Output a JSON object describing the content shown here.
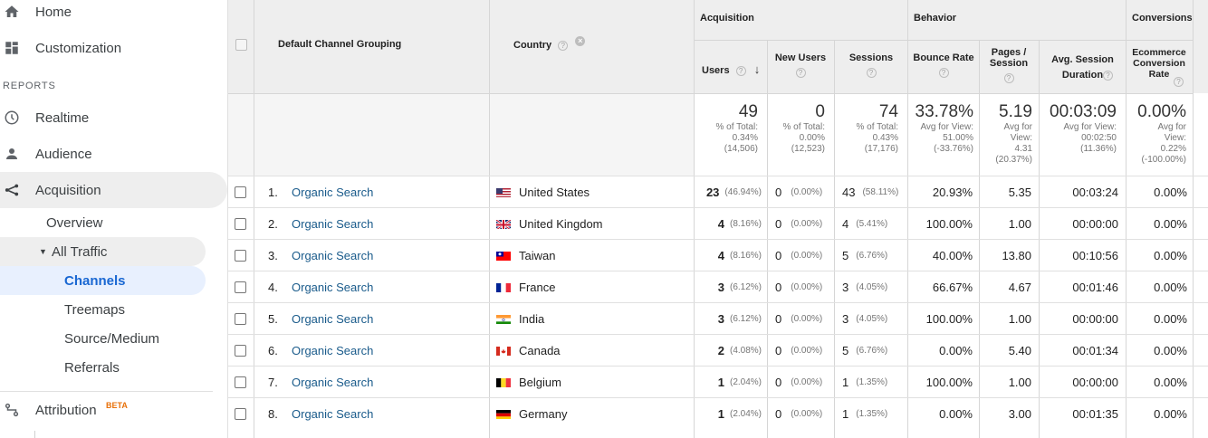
{
  "sidebar": {
    "home": "Home",
    "customization": "Customization",
    "reports_label": "REPORTS",
    "realtime": "Realtime",
    "audience": "Audience",
    "acquisition": "Acquisition",
    "overview": "Overview",
    "all_traffic": "All Traffic",
    "channels": "Channels",
    "treemaps": "Treemaps",
    "source_medium": "Source/Medium",
    "referrals": "Referrals",
    "attribution": "Attribution",
    "beta": "BETA"
  },
  "table": {
    "groups": {
      "acquisition": "Acquisition",
      "behavior": "Behavior",
      "conversions": "Conversions"
    },
    "columns": {
      "channel": "Default Channel Grouping",
      "country": "Country",
      "users": "Users",
      "new_users": "New Users",
      "sessions": "Sessions",
      "bounce_rate": "Bounce Rate",
      "pages_session": "Pages / Session",
      "avg_duration": "Avg. Session Duration",
      "ecom_rate": "Ecommerce Conversion Rate"
    },
    "totals": {
      "users": "49",
      "users_sub1": "% of Total:",
      "users_sub2": "0.34%",
      "users_sub3": "(14,506)",
      "new_users": "0",
      "new_users_sub1": "% of Total:",
      "new_users_sub2": "0.00%",
      "new_users_sub3": "(12,523)",
      "sessions": "74",
      "sessions_sub1": "% of Total:",
      "sessions_sub2": "0.43%",
      "sessions_sub3": "(17,176)",
      "bounce": "33.78%",
      "bounce_sub1": "Avg for View:",
      "bounce_sub2": "51.00%",
      "bounce_sub3": "(-33.76%)",
      "pages": "5.19",
      "pages_sub1": "Avg for",
      "pages_sub2": "View:",
      "pages_sub3": "4.31",
      "pages_sub4": "(20.37%)",
      "duration": "00:03:09",
      "duration_sub1": "Avg for View:",
      "duration_sub2": "00:02:50",
      "duration_sub3": "(11.36%)",
      "ecom": "0.00%",
      "ecom_sub1": "Avg for",
      "ecom_sub2": "View:",
      "ecom_sub3": "0.22%",
      "ecom_sub4": "(-100.00%)"
    },
    "rows": [
      {
        "num": "1.",
        "channel": "Organic Search",
        "country": "United States",
        "flag": "us",
        "users": "23",
        "users_pct": "(46.94%)",
        "new_users": "0",
        "new_pct": "(0.00%)",
        "sessions": "43",
        "sess_pct": "(58.11%)",
        "bounce": "20.93%",
        "pages": "5.35",
        "duration": "00:03:24",
        "ecom": "0.00%"
      },
      {
        "num": "2.",
        "channel": "Organic Search",
        "country": "United Kingdom",
        "flag": "uk",
        "users": "4",
        "users_pct": "(8.16%)",
        "new_users": "0",
        "new_pct": "(0.00%)",
        "sessions": "4",
        "sess_pct": "(5.41%)",
        "bounce": "100.00%",
        "pages": "1.00",
        "duration": "00:00:00",
        "ecom": "0.00%"
      },
      {
        "num": "3.",
        "channel": "Organic Search",
        "country": "Taiwan",
        "flag": "tw",
        "users": "4",
        "users_pct": "(8.16%)",
        "new_users": "0",
        "new_pct": "(0.00%)",
        "sessions": "5",
        "sess_pct": "(6.76%)",
        "bounce": "40.00%",
        "pages": "13.80",
        "duration": "00:10:56",
        "ecom": "0.00%"
      },
      {
        "num": "4.",
        "channel": "Organic Search",
        "country": "France",
        "flag": "fr",
        "users": "3",
        "users_pct": "(6.12%)",
        "new_users": "0",
        "new_pct": "(0.00%)",
        "sessions": "3",
        "sess_pct": "(4.05%)",
        "bounce": "66.67%",
        "pages": "4.67",
        "duration": "00:01:46",
        "ecom": "0.00%"
      },
      {
        "num": "5.",
        "channel": "Organic Search",
        "country": "India",
        "flag": "in",
        "users": "3",
        "users_pct": "(6.12%)",
        "new_users": "0",
        "new_pct": "(0.00%)",
        "sessions": "3",
        "sess_pct": "(4.05%)",
        "bounce": "100.00%",
        "pages": "1.00",
        "duration": "00:00:00",
        "ecom": "0.00%"
      },
      {
        "num": "6.",
        "channel": "Organic Search",
        "country": "Canada",
        "flag": "ca",
        "users": "2",
        "users_pct": "(4.08%)",
        "new_users": "0",
        "new_pct": "(0.00%)",
        "sessions": "5",
        "sess_pct": "(6.76%)",
        "bounce": "0.00%",
        "pages": "5.40",
        "duration": "00:01:34",
        "ecom": "0.00%"
      },
      {
        "num": "7.",
        "channel": "Organic Search",
        "country": "Belgium",
        "flag": "be",
        "users": "1",
        "users_pct": "(2.04%)",
        "new_users": "0",
        "new_pct": "(0.00%)",
        "sessions": "1",
        "sess_pct": "(1.35%)",
        "bounce": "100.00%",
        "pages": "1.00",
        "duration": "00:00:00",
        "ecom": "0.00%"
      },
      {
        "num": "8.",
        "channel": "Organic Search",
        "country": "Germany",
        "flag": "de",
        "users": "1",
        "users_pct": "(2.04%)",
        "new_users": "0",
        "new_pct": "(0.00%)",
        "sessions": "1",
        "sess_pct": "(1.35%)",
        "bounce": "0.00%",
        "pages": "3.00",
        "duration": "00:01:35",
        "ecom": "0.00%"
      }
    ]
  }
}
